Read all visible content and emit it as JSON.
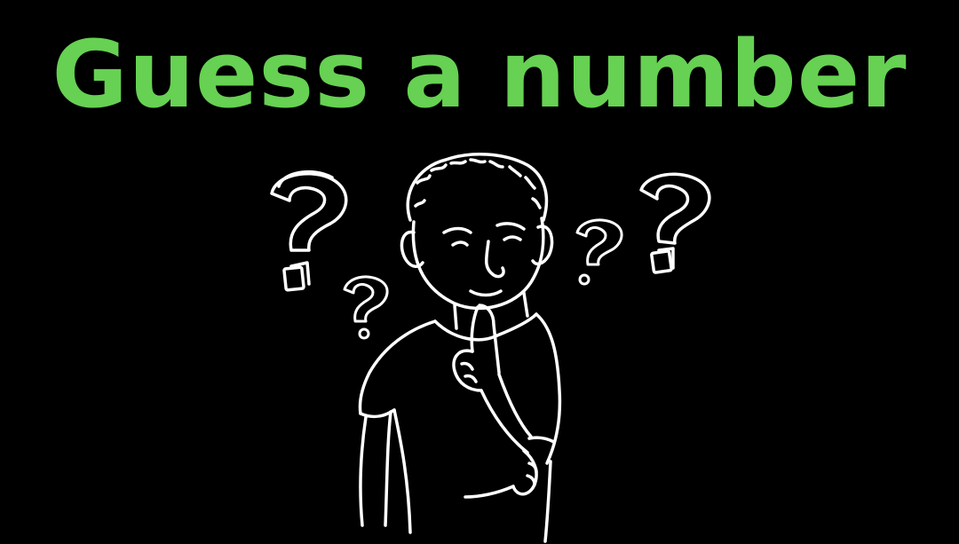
{
  "title": "Guess a number",
  "colors": {
    "background": "#000000",
    "title": "#66d152",
    "line_art": "#ffffff"
  },
  "illustration": {
    "subject": "thinking-person-icon",
    "decorations": [
      "question-mark-icon",
      "question-mark-icon",
      "question-mark-icon",
      "question-mark-icon"
    ]
  }
}
